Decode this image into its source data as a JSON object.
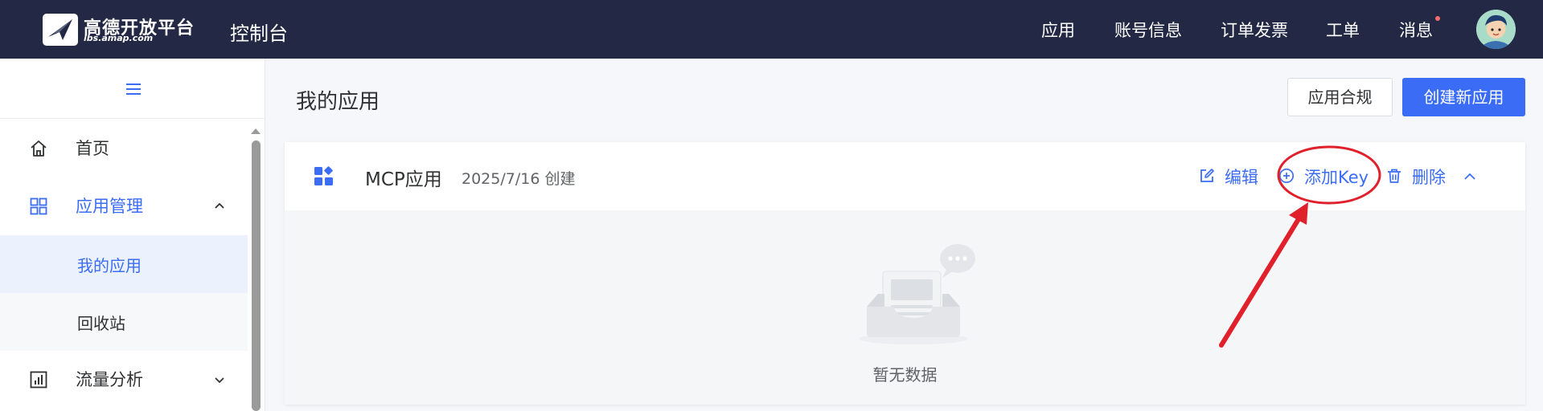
{
  "header": {
    "brand_name": "高德开放平台",
    "brand_url": "lbs.amap.com",
    "console_title": "控制台",
    "nav": {
      "apps": "应用",
      "account": "账号信息",
      "invoice": "订单发票",
      "ticket": "工单",
      "messages": "消息"
    },
    "has_unread_messages": true
  },
  "sidebar": {
    "items": [
      {
        "label": "首页",
        "icon": "home-icon"
      },
      {
        "label": "应用管理",
        "icon": "grid-icon",
        "expanded": true,
        "active": true
      },
      {
        "label": "我的应用",
        "sub": true,
        "selected": true
      },
      {
        "label": "回收站",
        "sub": true
      },
      {
        "label": "流量分析",
        "icon": "chart-icon",
        "expanded": false
      }
    ]
  },
  "main": {
    "title": "我的应用",
    "compliance_btn": "应用合规",
    "create_btn": "创建新应用",
    "app": {
      "name": "MCP应用",
      "created": "2025/7/16 创建",
      "actions": {
        "edit": "编辑",
        "add_key": "添加Key",
        "delete": "删除"
      },
      "empty_text": "暂无数据"
    }
  },
  "colors": {
    "header_bg": "#232945",
    "primary": "#3b6cf6",
    "annotation": "#e0202a"
  }
}
